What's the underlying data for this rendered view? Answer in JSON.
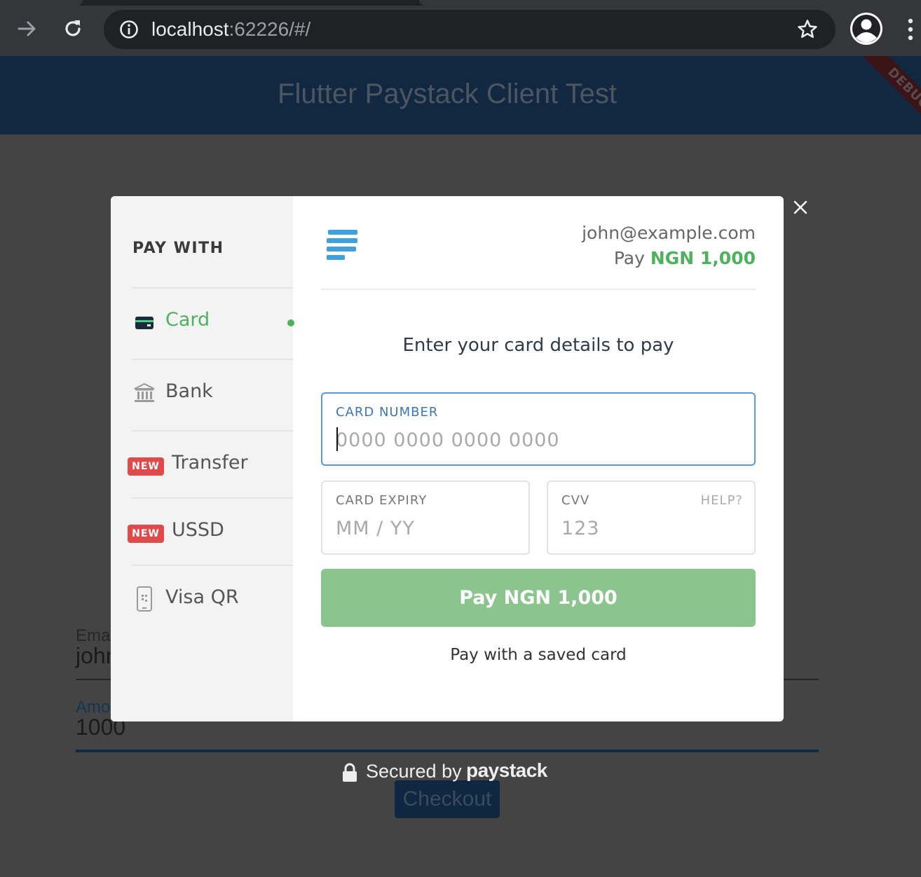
{
  "browser": {
    "url_host": "localhost",
    "url_rest": ":62226/#/"
  },
  "app": {
    "title": "Flutter Paystack Client Test",
    "debug_banner": "DEBUG",
    "email_label": "Ema",
    "email_value": "john",
    "amount_label": "Amo",
    "amount_value": "1000",
    "checkout_label": "Checkout"
  },
  "modal": {
    "pay_with_label": "PAY WITH",
    "methods": [
      {
        "label": "Card",
        "icon": "credit-card-icon",
        "active": true
      },
      {
        "label": "Bank",
        "icon": "bank-icon",
        "active": false
      },
      {
        "label": "Transfer",
        "badge": "NEW",
        "active": false
      },
      {
        "label": "USSD",
        "badge": "NEW",
        "active": false
      },
      {
        "label": "Visa QR",
        "icon": "qr-phone-icon",
        "active": false
      }
    ],
    "customer_email": "john@example.com",
    "pay_prefix": "Pay",
    "amount": "NGN 1,000",
    "instruction": "Enter your card details to pay",
    "card_number_label": "CARD NUMBER",
    "card_number_placeholder": "0000 0000 0000 0000",
    "card_expiry_label": "CARD EXPIRY",
    "card_expiry_placeholder": "MM / YY",
    "cvv_label": "CVV",
    "cvv_help": "HELP?",
    "cvv_placeholder": "123",
    "pay_button": "Pay NGN 1,000",
    "saved_card_link": "Pay with a saved card",
    "secured_by": "Secured by",
    "brand_name": "paystack"
  },
  "colors": {
    "accent_green": "#4eb15d",
    "pay_button": "#8bc58e",
    "focus_blue": "#5a9ad6",
    "badge_red": "#e04a4a",
    "logo_blue": "#3fa1dc"
  }
}
